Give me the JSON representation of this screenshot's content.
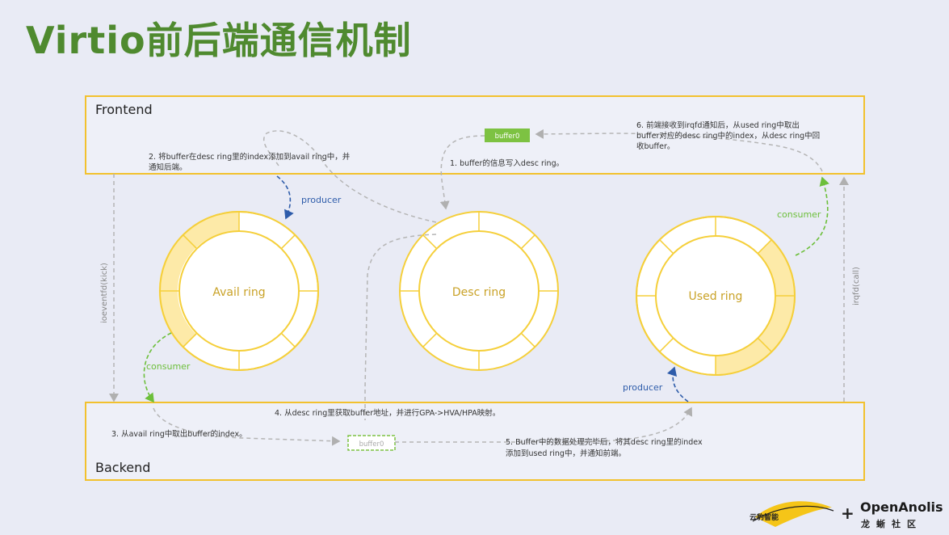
{
  "title": "Virtio前后端通信机制",
  "frontend_label": "Frontend",
  "backend_label": "Backend",
  "rings": {
    "avail": "Avail ring",
    "desc": "Desc ring",
    "used": "Used ring"
  },
  "buffer_label": "buffer0",
  "steps": {
    "s1": "1. buffer的信息写入desc ring。",
    "s2_line1": "2. 将buffer在desc ring里的index添加到avail ring中，并",
    "s2_line2": "通知后端。",
    "s3": "3. 从avail ring中取出buffer的index。",
    "s4": "4. 从desc ring里获取buffer地址，并进行GPA->HVA/HPA映射。",
    "s5_line1": "5. Buffer中的数据处理完毕后，将其desc ring里的index",
    "s5_line2": "添加到used ring中，并通知前端。",
    "s6_line1": "6. 前端接收到irqfd通知后，从used ring中取出",
    "s6_line2": "buffer对应的desc ring中的index，从desc ring中回",
    "s6_line3": "收buffer。"
  },
  "roles": {
    "producer_top": "producer",
    "consumer_left": "consumer",
    "consumer_right": "consumer",
    "producer_bottom": "producer"
  },
  "side_labels": {
    "kick": "ioeventfd(kick)",
    "call": "irqfd(call)"
  },
  "logos": {
    "left_brand_text": "云豹智能",
    "openanolis": "OpenAnolis",
    "openanolis_cn": "龙蜥社区",
    "plus": "+"
  },
  "colors": {
    "title": "#4f8a2f",
    "box_border": "#f2c12e",
    "ring_yellow": "#f5cf3a",
    "ring_fill": "#fdeaa8",
    "buffer_green": "#7dc242",
    "producer_blue": "#2e5caa",
    "consumer_green": "#6cbf3a",
    "arrow_gray": "#b5b5b5"
  }
}
